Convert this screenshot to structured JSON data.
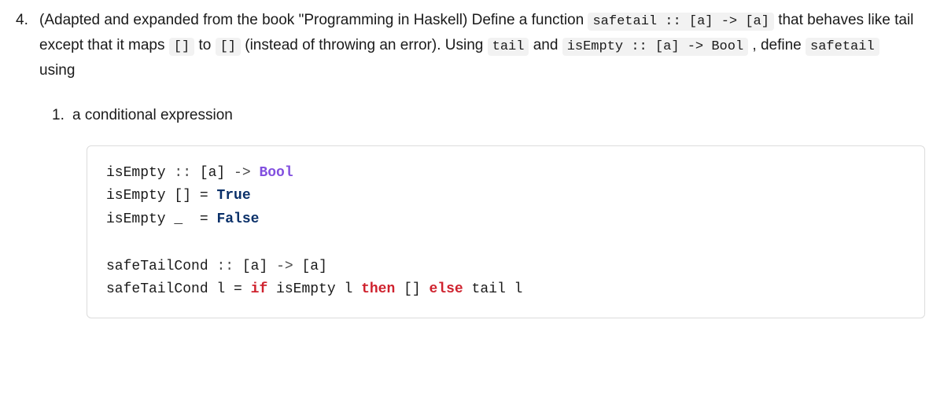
{
  "outer": {
    "num": "4.",
    "t1": "(Adapted and expanded from the book \"Programming in Haskell) Define a function ",
    "c1": "safetail :: [a] -> [a]",
    "t2": " that behaves like tail except that it maps ",
    "c2": "[]",
    "t3": " to ",
    "c3": "[]",
    "t4": " (instead of throwing an error). Using ",
    "c4": "tail",
    "t5": " and ",
    "c5": "isEmpty :: [a] -> Bool",
    "t6": ", define ",
    "c6": "safetail",
    "t7": "using"
  },
  "sub": {
    "num": "1.",
    "text": "a conditional expression"
  },
  "code": {
    "l1a": "isEmpty ",
    "l1b": ":: ",
    "l1c": "[a] ",
    "l1d": "-> ",
    "l1e": "Bool",
    "l2a": "isEmpty [] = ",
    "l2b": "True",
    "l3a": "isEmpty _  = ",
    "l3b": "False",
    "l4a": "safeTailCond ",
    "l4b": ":: ",
    "l4c": "[a] ",
    "l4d": "-> ",
    "l4e": "[a]",
    "l5a": "safeTailCond l = ",
    "l5b": "if",
    "l5c": " isEmpty l ",
    "l5d": "then",
    "l5e": " [] ",
    "l5f": "else",
    "l5g": " tail l"
  }
}
